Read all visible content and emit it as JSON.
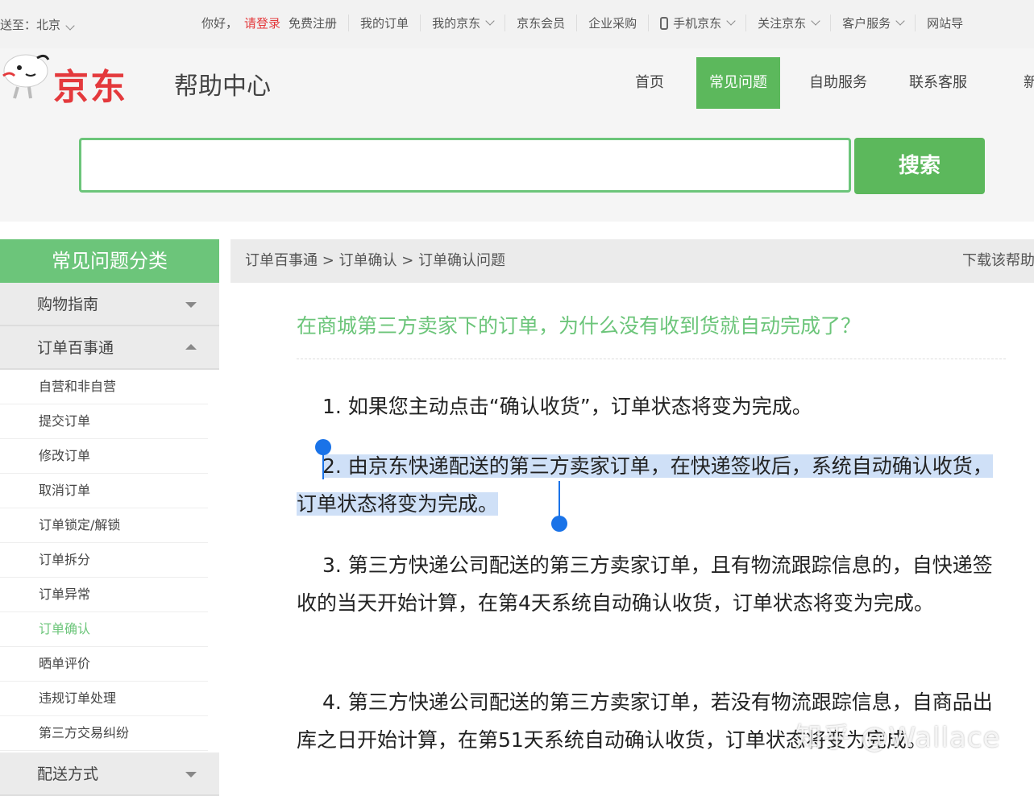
{
  "topbar": {
    "location": "送至：北京",
    "greeting": "你好，",
    "login": "请登录",
    "register": "免费注册",
    "links": [
      "我的订单",
      "我的京东",
      "京东会员",
      "企业采购",
      "手机京东",
      "关注京东",
      "客户服务",
      "网站导"
    ]
  },
  "header": {
    "logo_text": "京东",
    "title": "帮助中心",
    "nav": [
      "首页",
      "常见问题",
      "自助服务",
      "联系客服",
      "新手"
    ],
    "active_nav": "常见问题"
  },
  "search": {
    "value": "",
    "button": "搜索"
  },
  "sidebar": {
    "title": "常见问题分类",
    "categories": [
      {
        "label": "购物指南"
      },
      {
        "label": "订单百事通"
      }
    ],
    "subitems": [
      "自营和非自营",
      "提交订单",
      "修改订单",
      "取消订单",
      "订单锁定/解锁",
      "订单拆分",
      "订单异常",
      "订单确认",
      "晒单评价",
      "违规订单处理",
      "第三方交易纠纷"
    ],
    "active_sub": "订单确认",
    "last_category": "配送方式"
  },
  "breadcrumb": {
    "path": "订单百事通 > 订单确认 > 订单确认问题",
    "download": "下载该帮助"
  },
  "article": {
    "question": "在商城第三方卖家下的订单，为什么没有收到货就自动完成了？",
    "p1": "1. 如果您主动点击“确认收货”，订单状态将变为完成。",
    "p2": "2. 由京东快递配送的第三方卖家订单，在快递签收后，系统自动确认收货，订单状态将变为完成。",
    "p3": "3. 第三方快递公司配送的第三方卖家订单，且有物流跟踪信息的，自快递签收的当天开始计算，在第4天系统自动确认收货，订单状态将变为完成。",
    "p4": "4. 第三方快递公司配送的第三方卖家订单，若没有物流跟踪信息，自商品出库之日开始计算，在第51天系统自动确认收货，订单状态将变为完成。"
  },
  "watermark": "知乎 @Wallace",
  "colors": {
    "brand_red": "#e4393c",
    "accent_green": "#5cb85c",
    "selection": "#cfe0f7",
    "handle": "#1a73e8"
  }
}
